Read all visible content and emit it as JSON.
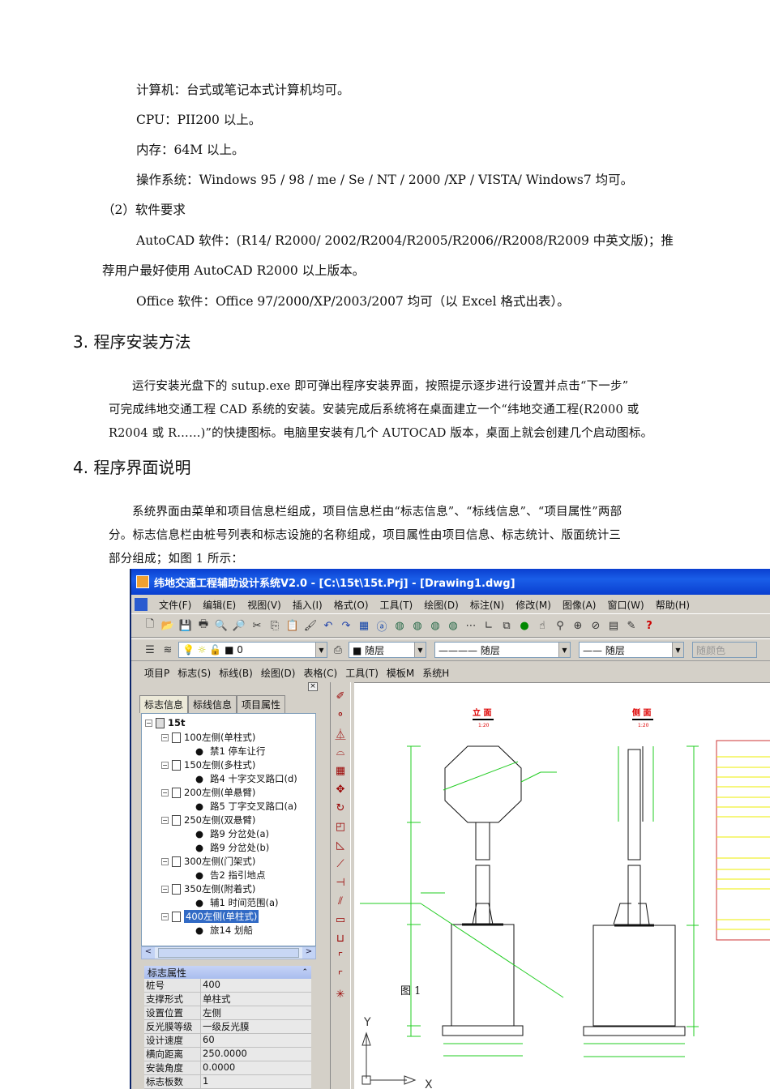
{
  "doc": {
    "lines": [
      "计算机：台式或笔记本式计算机均可。",
      "CPU：PII200 以上。",
      "内存：64M 以上。",
      "操作系统：Windows 95 / 98 / me / Se / NT / 2000 /XP / VISTA/ Windows7  均可。",
      "（2）软件要求",
      "AutoCAD 软件：(R14/ R2000/ 2002/R2004/R2005/R2006//R2008/R2009 中英文版)；推",
      "荐用户最好使用 AutoCAD R2000 以上版本。",
      "Office 软件：Office 97/2000/XP/2003/2007 均可（以 Excel 格式出表）。"
    ],
    "h3": "3.  程序安装方法",
    "p3": [
      "运行安装光盘下的 sutup.exe 即可弹出程序安装界面，按照提示逐步进行设置并点击“下一步”",
      "可完成纬地交通工程 CAD 系统的安装。安装完成后系统将在桌面建立一个“纬地交通工程(R2000 或",
      "R2004 或 R……)”的快捷图标。电脑里安装有几个 AUTOCAD 版本，桌面上就会创建几个启动图标。"
    ],
    "h4": "4.  程序界面说明",
    "p4": [
      "系统界面由菜单和项目信息栏组成，项目信息栏由“标志信息”、“标线信息”、“项目属性”两部",
      "分。标志信息栏由桩号列表和标志设施的名称组成，项目属性由项目信息、标志统计、版面统计三",
      "部分组成；如图 1 所示："
    ],
    "caption": "图 1"
  },
  "app": {
    "title": "纬地交通工程辅助设计系统V2.0 - [C:\\15t\\15t.Prj] - [Drawing1.dwg]",
    "menu": [
      "文件(F)",
      "编辑(E)",
      "视图(V)",
      "插入(I)",
      "格式(O)",
      "工具(T)",
      "绘图(D)",
      "标注(N)",
      "修改(M)",
      "图像(A)",
      "窗口(W)",
      "帮助(H)"
    ],
    "layer_value": "0",
    "color_value": "随层",
    "linetype_value": "随层",
    "lineweight_value": "随层",
    "plotstyle_value": "随颜色",
    "menu2": [
      "项目P",
      "标志(S)",
      "标线(B)",
      "绘图(D)",
      "表格(C)",
      "工具(T)",
      "模板M",
      "系统H"
    ],
    "tabs": [
      "标志信息",
      "标线信息",
      "项目属性"
    ],
    "tree": {
      "root": "15t",
      "groups": [
        {
          "label": "100左侧(单柱式)",
          "items": [
            "禁1 停车让行"
          ]
        },
        {
          "label": "150左侧(多柱式)",
          "items": [
            "路4 十字交叉路口(d)"
          ]
        },
        {
          "label": "200左侧(单悬臂)",
          "items": [
            "路5 丁字交叉路口(a)"
          ]
        },
        {
          "label": "250左侧(双悬臂)",
          "items": [
            "路9 分岔处(a)",
            "路9 分岔处(b)"
          ]
        },
        {
          "label": "300左侧(门架式)",
          "items": [
            "告2 指引地点"
          ]
        },
        {
          "label": "350左侧(附着式)",
          "items": [
            "辅1 时间范围(a)"
          ]
        },
        {
          "label": "400左侧(单柱式)",
          "items": [
            "旅14 划船"
          ]
        }
      ]
    },
    "props_title": "标志属性",
    "props": [
      [
        "桩号",
        "400"
      ],
      [
        "支撑形式",
        "单柱式"
      ],
      [
        "设置位置",
        "左侧"
      ],
      [
        "反光膜等级",
        "一级反光膜"
      ],
      [
        "设计速度",
        "60"
      ],
      [
        "横向距离",
        "250.0000"
      ],
      [
        "安装角度",
        "0.0000"
      ],
      [
        "标志板数",
        "1"
      ]
    ],
    "drawing": {
      "front": "立 面",
      "side": "侧 面",
      "scale": "1:20",
      "axis_x": "X",
      "axis_y": "Y"
    }
  }
}
